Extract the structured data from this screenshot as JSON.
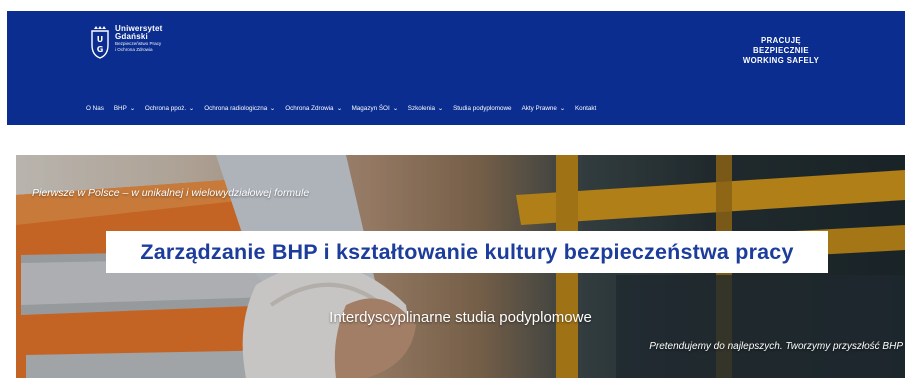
{
  "header": {
    "logo": {
      "university": "Uniwersytet",
      "city": "Gdański",
      "unit_line1": "Bezpieczeństwo Pracy",
      "unit_line2": "i Ochrona Zdrowia"
    },
    "tagline": [
      "PRACUJĘ",
      "BEZPIECZNIE",
      "WORKING SAFELY"
    ],
    "nav": [
      {
        "label": "O Nas",
        "has_dropdown": false
      },
      {
        "label": "BHP",
        "has_dropdown": true
      },
      {
        "label": "Ochrona ppoż.",
        "has_dropdown": true
      },
      {
        "label": "Ochrona radiologiczna",
        "has_dropdown": true
      },
      {
        "label": "Ochrona Zdrowia",
        "has_dropdown": true
      },
      {
        "label": "Magazyn ŚOI",
        "has_dropdown": true
      },
      {
        "label": "Szkolenia",
        "has_dropdown": true
      },
      {
        "label": "Studia podyplomowe",
        "has_dropdown": false
      },
      {
        "label": "Akty Prawne",
        "has_dropdown": true
      },
      {
        "label": "Kontakt",
        "has_dropdown": false
      }
    ],
    "caret": "⌄"
  },
  "hero": {
    "kicker": "Pierwsze w Polsce – w unikalnej i wielowydziałowej formule",
    "title": "Zarządzanie BHP i kształtowanie kultury bezpieczeństwa pracy",
    "subtitle": "Interdyscyplinarne studia podyplomowe",
    "slogan": "Pretendujemy do najlepszych. Tworzymy przyszłość BHP"
  },
  "colors": {
    "header_bg": "#0a2d8f",
    "title_color": "#1d3d9c",
    "vest_orange": "#f07a2a",
    "rail_yellow": "#e0a21c"
  }
}
